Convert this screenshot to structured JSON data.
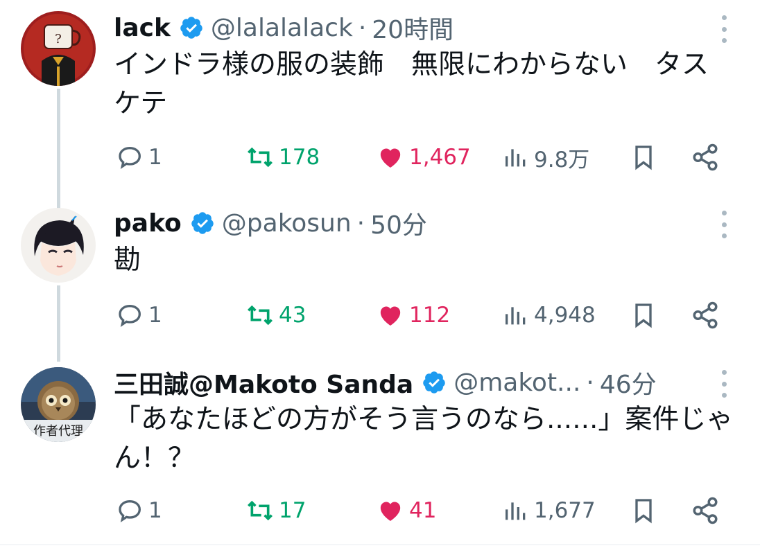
{
  "colors": {
    "verified": "#1d9bf0",
    "retweet": "#00a36c",
    "like": "#e0245e",
    "muted": "#536471",
    "text": "#0f1419"
  },
  "tweets": [
    {
      "name": "lack",
      "handle": "@lalalalack",
      "separator": "·",
      "time": "20時間",
      "text": "インドラ様の服の装飾　無限にわからない　タスケテ",
      "replies": "1",
      "retweets": "178",
      "likes": "1,467",
      "views": "9.8万",
      "avatar_icon": "teacup-avatar"
    },
    {
      "name": "pako",
      "handle": "@pakosun",
      "separator": "·",
      "time": "50分",
      "text": "勘",
      "replies": "1",
      "retweets": "43",
      "likes": "112",
      "views": "4,948",
      "avatar_icon": "anime-boy-avatar"
    },
    {
      "name": "三田誠@Makoto Sanda",
      "handle": "@makot...",
      "separator": "·",
      "time": "46分",
      "text": "「あなたほどの方がそう言うのなら......」案件じゃん！？",
      "replies": "1",
      "retweets": "17",
      "likes": "41",
      "views": "1,677",
      "avatar_icon": "owl-avatar",
      "avatar_caption": "作者代理"
    }
  ]
}
